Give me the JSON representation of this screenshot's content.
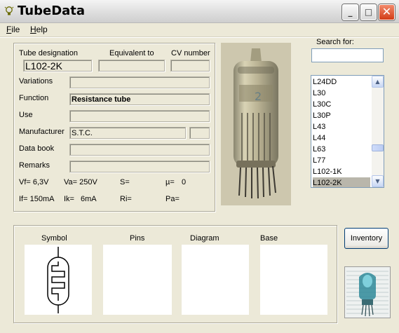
{
  "window": {
    "title": "TubeData",
    "icon": "lightbulb-icon"
  },
  "menu": [
    {
      "label": "File",
      "accel": "F",
      "rest": "ile"
    },
    {
      "label": "Help",
      "accel": "H",
      "rest": "elp"
    }
  ],
  "header_labels": {
    "designation": "Tube designation",
    "equivalent": "Equivalent to",
    "cv": "CV number"
  },
  "fields": {
    "designation": "L102-2K",
    "equivalent": "",
    "cv": "",
    "variations": "",
    "function": "Resistance tube",
    "use": "",
    "manufacturer": "S.T.C.",
    "manufacturer_code": "",
    "data_book": "",
    "remarks": ""
  },
  "field_labels": {
    "variations": "Variations",
    "function": "Function",
    "use": "Use",
    "manufacturer": "Manufacturer",
    "data_book": "Data book",
    "remarks": "Remarks"
  },
  "params": {
    "vf": "Vf= 6,3V",
    "va": "Va= 250V",
    "s": "S=",
    "mu": "µ=",
    "mu_val": "0",
    "if": "If= 150mA",
    "ik": "Ik=",
    "ik_val": "6mA",
    "ri": "Ri=",
    "pa": "Pa="
  },
  "search": {
    "label": "Search for:",
    "value": ""
  },
  "tube_list": [
    "L24DD",
    "L30",
    "L30C",
    "L30P",
    "L43",
    "L44",
    "L63",
    "L77",
    "L102-1K",
    "L102-2K"
  ],
  "selected_tube": "L102-2K",
  "panels": {
    "symbol": "Symbol",
    "pins": "Pins",
    "diagram": "Diagram",
    "base": "Base"
  },
  "buttons": {
    "inventory": "Inventory"
  }
}
